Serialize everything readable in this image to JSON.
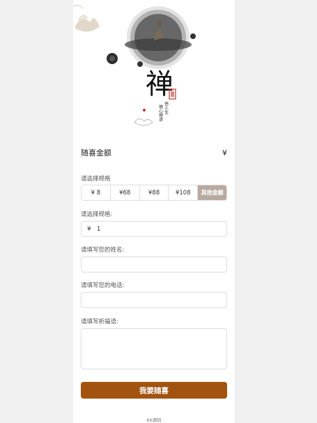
{
  "hero": {
    "calligraphy": "禅",
    "vertical_text_1": "悟人生",
    "vertical_text_2": "佛心禅语"
  },
  "amount": {
    "label": "随喜金额",
    "currency": "¥"
  },
  "spec": {
    "label": "请选择规格",
    "options": [
      "¥ 8",
      "¥68",
      "¥88",
      "¥108",
      "其他金额"
    ],
    "selected_index": 4
  },
  "custom_amount": {
    "label": "请选择规格:",
    "currency": "¥",
    "value": "1"
  },
  "name_field": {
    "label": "请填写您的姓名:",
    "value": ""
  },
  "phone_field": {
    "label": "请填写您的电话:",
    "value": ""
  },
  "blessing_field": {
    "label": "请填写祈福语:",
    "value": ""
  },
  "submit": {
    "label": "我要随喜"
  },
  "footer": {
    "text": "66源码"
  },
  "colors": {
    "button": "#a2530f",
    "selected_option": "#b7aaa0",
    "page_bg": "#f0f0f0"
  }
}
